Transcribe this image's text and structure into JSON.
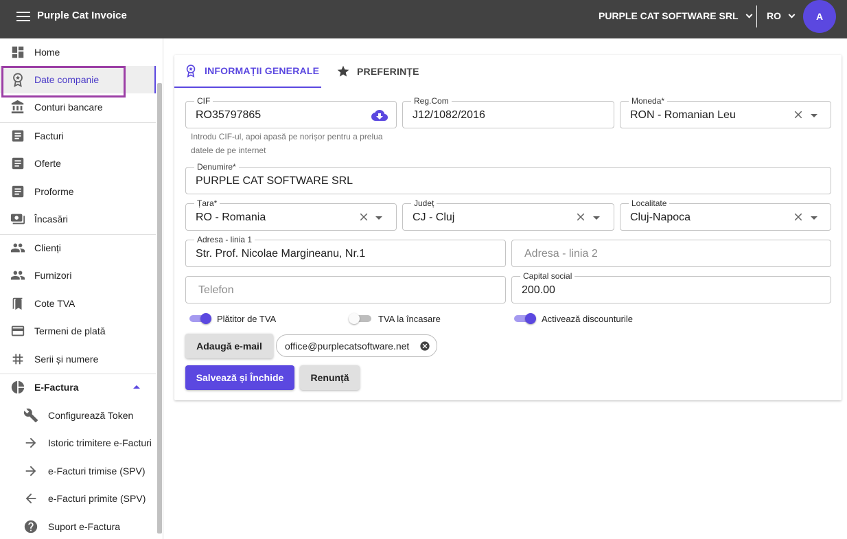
{
  "app": {
    "title": "Purple Cat Invoice",
    "company": "PURPLE CAT SOFTWARE SRL",
    "language": "RO",
    "avatar_initial": "A",
    "accent_color": "#5b48e0"
  },
  "sidebar": {
    "items": [
      {
        "label": "Home",
        "icon": "dashboard-icon"
      },
      {
        "label": "Date companie",
        "icon": "badge-icon",
        "active": true
      },
      {
        "label": "Conturi bancare",
        "icon": "bank-icon"
      },
      {
        "label": "Facturi",
        "icon": "document-icon"
      },
      {
        "label": "Oferte",
        "icon": "document-icon"
      },
      {
        "label": "Proforme",
        "icon": "document-icon"
      },
      {
        "label": "Încasări",
        "icon": "cash-icon"
      },
      {
        "label": "Clienți",
        "icon": "people-icon"
      },
      {
        "label": "Furnizori",
        "icon": "people-icon"
      },
      {
        "label": "Cote TVA",
        "icon": "bookmark-icon"
      },
      {
        "label": "Termeni de plată",
        "icon": "credit-card-icon"
      },
      {
        "label": "Serii și numere",
        "icon": "hash-icon"
      },
      {
        "label": "E-Factura",
        "icon": "pie-icon",
        "expanded": true
      },
      {
        "label": "Configurează Token",
        "icon": "wrench-icon"
      },
      {
        "label": "Istoric trimitere e-Facturi",
        "icon": "arrow-right-icon"
      },
      {
        "label": "e-Facturi trimise (SPV)",
        "icon": "arrow-right-icon"
      },
      {
        "label": "e-Facturi primite (SPV)",
        "icon": "arrow-left-icon"
      },
      {
        "label": "Suport e-Factura",
        "icon": "help-icon"
      }
    ]
  },
  "tabs": {
    "general": "INFORMAȚII GENERALE",
    "preferences": "PREFERINȚE"
  },
  "form": {
    "cif": {
      "label": "CIF",
      "value": "RO35797865"
    },
    "cif_helper": "Introdu CIF-ul, apoi apasă pe norișor pentru a prelua datele de pe internet",
    "regcom": {
      "label": "Reg.Com",
      "value": "J12/1082/2016"
    },
    "currency": {
      "label": "Moneda*",
      "value": "RON - Romanian Leu"
    },
    "name": {
      "label": "Denumire*",
      "value": "PURPLE CAT SOFTWARE SRL"
    },
    "country": {
      "label": "Țara*",
      "value": "RO - Romania"
    },
    "county": {
      "label": "Județ",
      "value": "CJ - Cluj"
    },
    "city": {
      "label": "Localitate",
      "value": "Cluj-Napoca"
    },
    "address1": {
      "label": "Adresa - linia 1",
      "value": "Str. Prof. Nicolae Margineanu, Nr.1"
    },
    "address2": {
      "placeholder": "Adresa - linia 2"
    },
    "phone": {
      "placeholder": "Telefon"
    },
    "capital": {
      "label": "Capital social",
      "value": "200.00"
    },
    "toggles": {
      "vat_payer": {
        "label": "Plătitor de TVA",
        "on": true
      },
      "vat_on_collection": {
        "label": "TVA la încasare",
        "on": false
      },
      "discounts": {
        "label": "Activează discounturile",
        "on": true
      }
    },
    "add_email_label": "Adaugă e-mail",
    "email_chip": "office@purplecatsoftware.net",
    "save_label": "Salvează și Închide",
    "cancel_label": "Renunță"
  }
}
